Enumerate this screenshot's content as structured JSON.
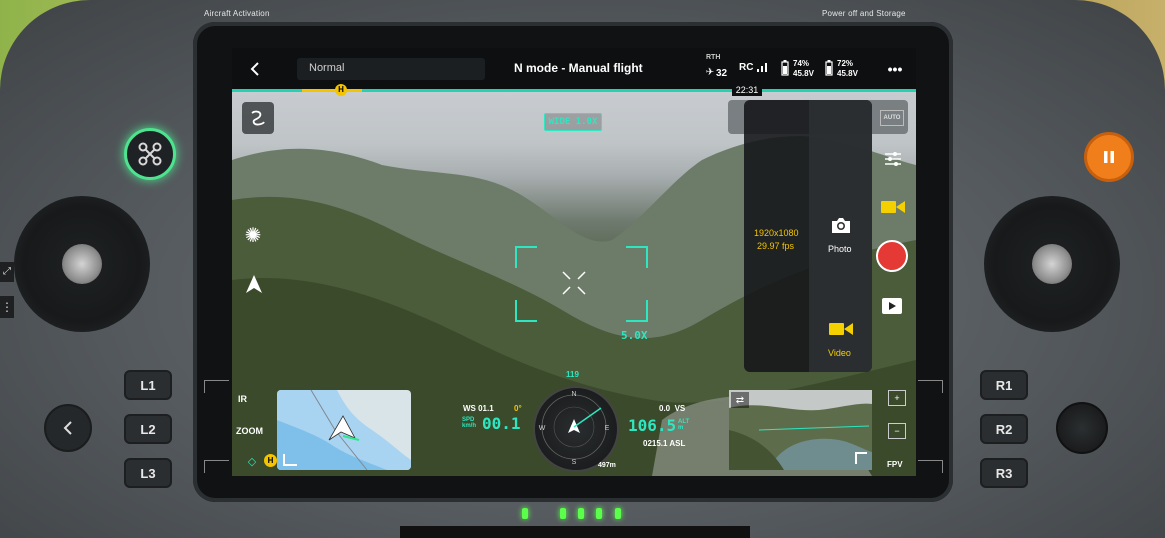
{
  "controller": {
    "left_label": "Aircraft Activation",
    "right_label": "Power off and Storage",
    "buttons": {
      "l1": "L1",
      "l2": "L2",
      "l3": "L3",
      "r1": "R1",
      "r2": "R2",
      "r3": "R3"
    }
  },
  "topbar": {
    "mode_select": "Normal",
    "title": "N mode - Manual flight",
    "rth_label": "RTH",
    "satellites": "32",
    "rc_label": "RC",
    "battery1_percent": "74%",
    "battery1_voltage": "45.8V",
    "battery2_percent": "72%",
    "battery2_voltage": "45.8V",
    "time_badge": "22:31",
    "home_marker": "H"
  },
  "camera": {
    "lens_badge": "WIDE 1.0X",
    "zoom_level": "5.0X",
    "auto_label": "AUTO"
  },
  "capture_panel": {
    "resolution": "1920x1080",
    "fps": "29.97 fps",
    "photo_label": "Photo",
    "video_label": "Video"
  },
  "left_controls": {
    "ir_label": "IR",
    "zoom_label": "ZOOM"
  },
  "telemetry": {
    "ws_label": "WS 01.1",
    "ws_angle": "0°",
    "spd_label": "SPD\nkm/h",
    "speed": "00.1",
    "heading": "119",
    "vs_label": "0.0  VS",
    "altitude": "106.5",
    "alt_unit": "ALT\nm",
    "asl": "0215.1 ASL",
    "distance": "497m"
  },
  "pip": {
    "fpv_label": "FPV"
  },
  "colors": {
    "accent": "#2ee6c0",
    "record": "#e53935",
    "video_icon": "#f5d000",
    "pause_button": "#f07f1b",
    "led": "#5bff4b"
  }
}
